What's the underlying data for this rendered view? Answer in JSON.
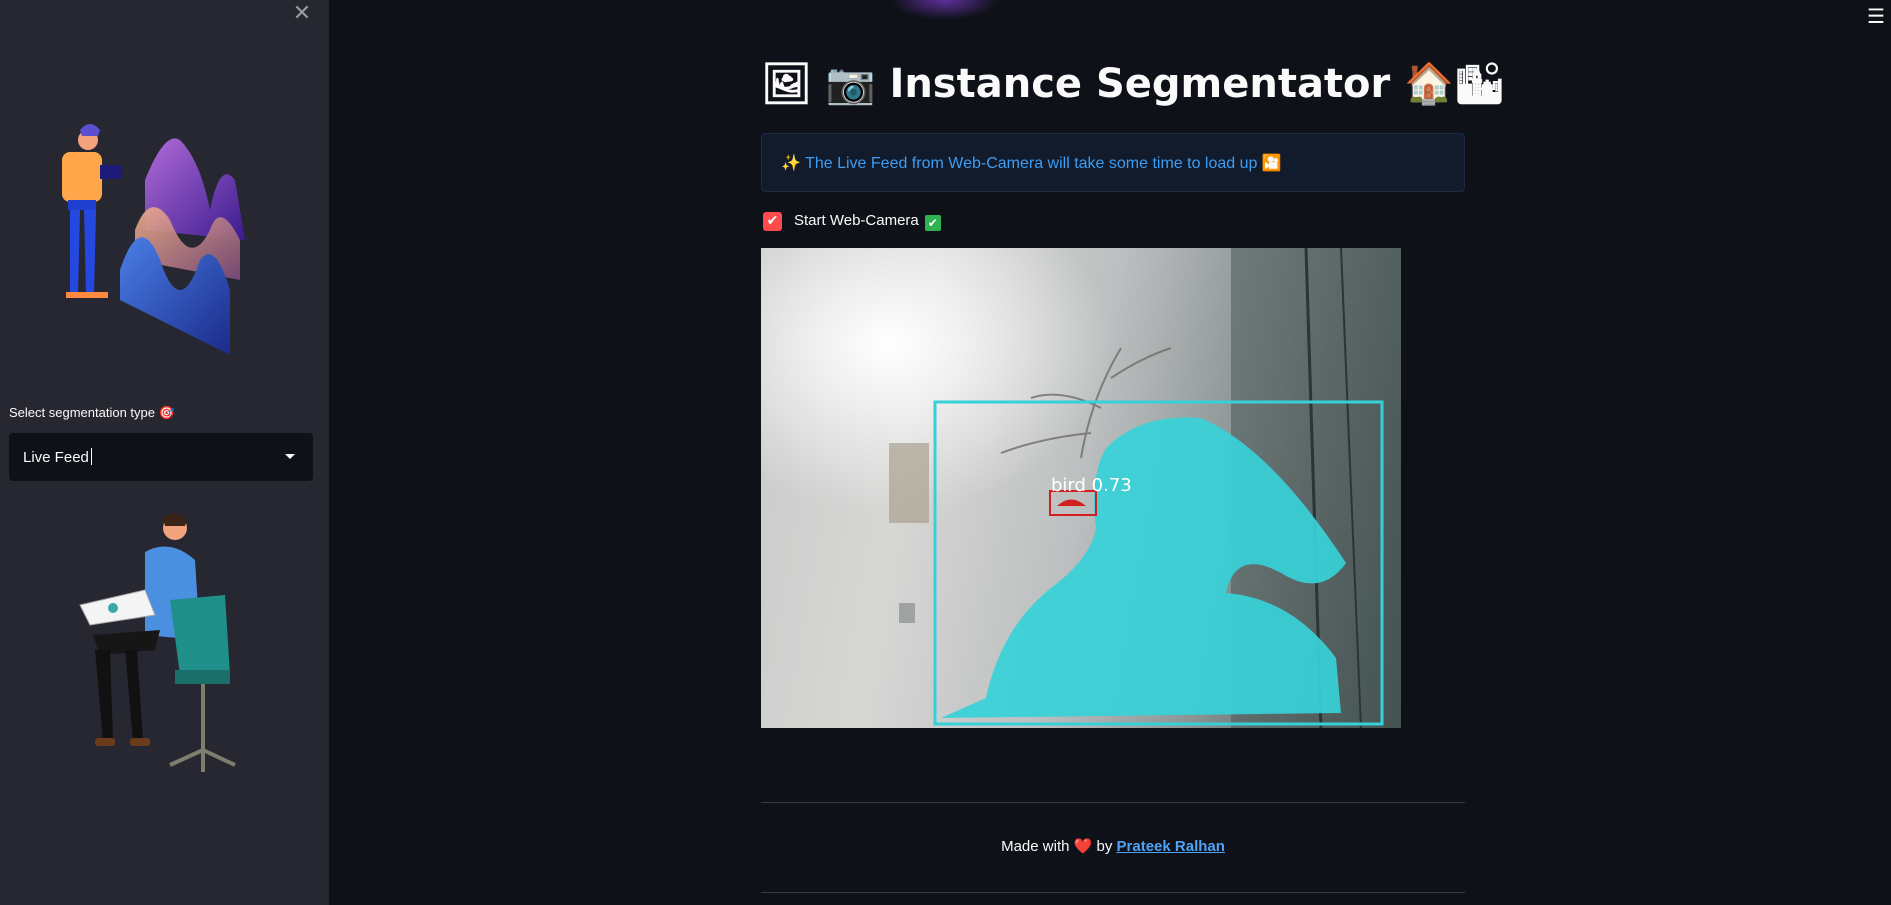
{
  "sidebar": {
    "select_label": "Select segmentation type 🎯",
    "select_value": "Live Feed"
  },
  "main": {
    "title": "🖼 📷 Instance Segmentator 🏠🏙",
    "info_message": "✨ The Live Feed from Web-Camera will take some time to load up 🎦",
    "checkbox_label": "Start Web-Camera",
    "detection_label": "bird 0.73",
    "footer": {
      "made_with": "Made with",
      "heart": "❤️",
      "by": "by",
      "author": "Prateek Ralhan"
    }
  },
  "colors": {
    "accent": "#ff4b4b",
    "info_text": "#3d9df3",
    "link": "#4fa3f7",
    "mask": "#36d1d8",
    "bbox": "#d21e1e"
  }
}
